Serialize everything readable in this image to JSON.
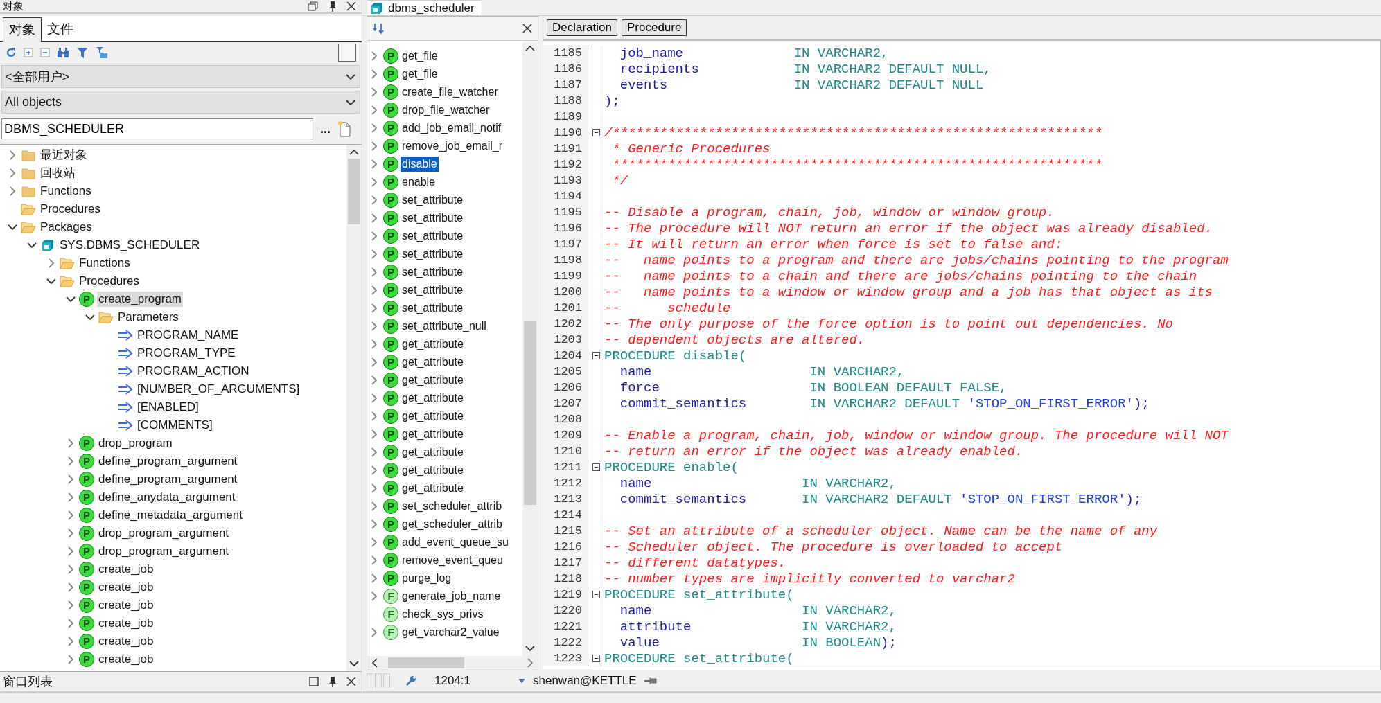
{
  "left_panel": {
    "title": "对象",
    "tabs": [
      {
        "label": "对象",
        "selected": true
      },
      {
        "label": "文件",
        "selected": false
      }
    ],
    "owner_dropdown": {
      "value": "<全部用户>"
    },
    "type_dropdown": {
      "value": "All objects"
    },
    "filter": {
      "value": "DBMS_SCHEDULER",
      "browse_button": "..."
    },
    "tree": [
      {
        "label": "最近对象",
        "kind": "folder",
        "expanded": false,
        "selected": false
      },
      {
        "label": "回收站",
        "kind": "folder",
        "expanded": false,
        "selected": false
      },
      {
        "label": "Functions",
        "kind": "folder",
        "expanded": false,
        "selected": false
      },
      {
        "label": "Procedures",
        "kind": "open-folder",
        "selected": false
      },
      {
        "label": "Packages",
        "kind": "open-folder",
        "expanded": true,
        "selected": false,
        "children": [
          {
            "label": "SYS.DBMS_SCHEDULER",
            "kind": "package",
            "expanded": true,
            "selected": false,
            "children": [
              {
                "label": "Functions",
                "kind": "open-folder",
                "expanded": false,
                "selected": false
              },
              {
                "label": "Procedures",
                "kind": "open-folder",
                "expanded": true,
                "selected": false,
                "children": [
                  {
                    "label": "create_program",
                    "kind": "procedure",
                    "badge": "P",
                    "expanded": true,
                    "selected": true,
                    "children": [
                      {
                        "label": "Parameters",
                        "kind": "open-folder",
                        "expanded": true,
                        "selected": false,
                        "children": [
                          {
                            "label": "PROGRAM_NAME",
                            "kind": "parameter",
                            "selected": false
                          },
                          {
                            "label": "PROGRAM_TYPE",
                            "kind": "parameter",
                            "selected": false
                          },
                          {
                            "label": "PROGRAM_ACTION",
                            "kind": "parameter",
                            "selected": false
                          },
                          {
                            "label": "[NUMBER_OF_ARGUMENTS]",
                            "kind": "parameter",
                            "selected": false
                          },
                          {
                            "label": "[ENABLED]",
                            "kind": "parameter",
                            "selected": false
                          },
                          {
                            "label": "[COMMENTS]",
                            "kind": "parameter",
                            "selected": false
                          }
                        ]
                      }
                    ]
                  },
                  {
                    "label": "drop_program",
                    "kind": "procedure",
                    "badge": "P",
                    "expanded": false,
                    "selected": false
                  },
                  {
                    "label": "define_program_argument",
                    "kind": "procedure",
                    "badge": "P",
                    "expanded": false,
                    "selected": false
                  },
                  {
                    "label": "define_program_argument",
                    "kind": "procedure",
                    "badge": "P",
                    "expanded": false,
                    "selected": false
                  },
                  {
                    "label": "define_anydata_argument",
                    "kind": "procedure",
                    "badge": "P",
                    "expanded": false,
                    "selected": false
                  },
                  {
                    "label": "define_metadata_argument",
                    "kind": "procedure",
                    "badge": "P",
                    "expanded": false,
                    "selected": false
                  },
                  {
                    "label": "drop_program_argument",
                    "kind": "procedure",
                    "badge": "P",
                    "expanded": false,
                    "selected": false
                  },
                  {
                    "label": "drop_program_argument",
                    "kind": "procedure",
                    "badge": "P",
                    "expanded": false,
                    "selected": false
                  },
                  {
                    "label": "create_job",
                    "kind": "procedure",
                    "badge": "P",
                    "expanded": false,
                    "selected": false
                  },
                  {
                    "label": "create_job",
                    "kind": "procedure",
                    "badge": "P",
                    "expanded": false,
                    "selected": false
                  },
                  {
                    "label": "create_job",
                    "kind": "procedure",
                    "badge": "P",
                    "expanded": false,
                    "selected": false
                  },
                  {
                    "label": "create_job",
                    "kind": "procedure",
                    "badge": "P",
                    "expanded": false,
                    "selected": false
                  },
                  {
                    "label": "create_job",
                    "kind": "procedure",
                    "badge": "P",
                    "expanded": false,
                    "selected": false
                  },
                  {
                    "label": "create_job",
                    "kind": "procedure",
                    "badge": "P",
                    "expanded": false,
                    "selected": false
                  }
                ]
              }
            ]
          }
        ]
      }
    ]
  },
  "window_list": {
    "title": "窗口列表"
  },
  "editor": {
    "tab": {
      "label": "dbms_scheduler",
      "selected": true
    },
    "outline": [
      {
        "label": "get_file",
        "kind": "procedure",
        "badge": "P",
        "expanded": false,
        "selected": false
      },
      {
        "label": "get_file",
        "kind": "procedure",
        "badge": "P",
        "expanded": false,
        "selected": false
      },
      {
        "label": "create_file_watcher",
        "kind": "procedure",
        "badge": "P",
        "expanded": false,
        "selected": false
      },
      {
        "label": "drop_file_watcher",
        "kind": "procedure",
        "badge": "P",
        "expanded": false,
        "selected": false
      },
      {
        "label": "add_job_email_notif",
        "kind": "procedure",
        "badge": "P",
        "expanded": false,
        "selected": false
      },
      {
        "label": "remove_job_email_r",
        "kind": "procedure",
        "badge": "P",
        "expanded": false,
        "selected": false
      },
      {
        "label": "disable",
        "kind": "procedure",
        "badge": "P",
        "expanded": false,
        "selected": true
      },
      {
        "label": "enable",
        "kind": "procedure",
        "badge": "P",
        "expanded": false,
        "selected": false
      },
      {
        "label": "set_attribute",
        "kind": "procedure",
        "badge": "P",
        "expanded": false,
        "selected": false
      },
      {
        "label": "set_attribute",
        "kind": "procedure",
        "badge": "P",
        "expanded": false,
        "selected": false
      },
      {
        "label": "set_attribute",
        "kind": "procedure",
        "badge": "P",
        "expanded": false,
        "selected": false
      },
      {
        "label": "set_attribute",
        "kind": "procedure",
        "badge": "P",
        "expanded": false,
        "selected": false
      },
      {
        "label": "set_attribute",
        "kind": "procedure",
        "badge": "P",
        "expanded": false,
        "selected": false
      },
      {
        "label": "set_attribute",
        "kind": "procedure",
        "badge": "P",
        "expanded": false,
        "selected": false
      },
      {
        "label": "set_attribute",
        "kind": "procedure",
        "badge": "P",
        "expanded": false,
        "selected": false
      },
      {
        "label": "set_attribute_null",
        "kind": "procedure",
        "badge": "P",
        "expanded": false,
        "selected": false
      },
      {
        "label": "get_attribute",
        "kind": "procedure",
        "badge": "P",
        "expanded": false,
        "selected": false
      },
      {
        "label": "get_attribute",
        "kind": "procedure",
        "badge": "P",
        "expanded": false,
        "selected": false
      },
      {
        "label": "get_attribute",
        "kind": "procedure",
        "badge": "P",
        "expanded": false,
        "selected": false
      },
      {
        "label": "get_attribute",
        "kind": "procedure",
        "badge": "P",
        "expanded": false,
        "selected": false
      },
      {
        "label": "get_attribute",
        "kind": "procedure",
        "badge": "P",
        "expanded": false,
        "selected": false
      },
      {
        "label": "get_attribute",
        "kind": "procedure",
        "badge": "P",
        "expanded": false,
        "selected": false
      },
      {
        "label": "get_attribute",
        "kind": "procedure",
        "badge": "P",
        "expanded": false,
        "selected": false
      },
      {
        "label": "get_attribute",
        "kind": "procedure",
        "badge": "P",
        "expanded": false,
        "selected": false
      },
      {
        "label": "get_attribute",
        "kind": "procedure",
        "badge": "P",
        "expanded": false,
        "selected": false
      },
      {
        "label": "set_scheduler_attrib",
        "kind": "procedure",
        "badge": "P",
        "expanded": false,
        "selected": false
      },
      {
        "label": "get_scheduler_attrib",
        "kind": "procedure",
        "badge": "P",
        "expanded": false,
        "selected": false
      },
      {
        "label": "add_event_queue_su",
        "kind": "procedure",
        "badge": "P",
        "expanded": false,
        "selected": false
      },
      {
        "label": "remove_event_queu",
        "kind": "procedure",
        "badge": "P",
        "expanded": false,
        "selected": false
      },
      {
        "label": "purge_log",
        "kind": "procedure",
        "badge": "P",
        "expanded": false,
        "selected": false
      },
      {
        "label": "generate_job_name",
        "kind": "function",
        "badge": "F",
        "expanded": false,
        "selected": false
      },
      {
        "label": "check_sys_privs",
        "kind": "function",
        "badge": "F",
        "selected": false
      },
      {
        "label": "get_varchar2_value",
        "kind": "function",
        "badge": "F",
        "expanded": false,
        "selected": false
      }
    ],
    "view_buttons": [
      "Declaration",
      "Procedure"
    ],
    "lines": [
      {
        "number": "1185",
        "fold": false,
        "segments": [
          {
            "kind": "ident",
            "text": "  job_name              "
          },
          {
            "kind": "keyword",
            "text": "IN VARCHAR2,"
          }
        ]
      },
      {
        "number": "1186",
        "fold": false,
        "segments": [
          {
            "kind": "ident",
            "text": "  recipients            "
          },
          {
            "kind": "keyword",
            "text": "IN VARCHAR2 DEFAULT NULL,"
          }
        ]
      },
      {
        "number": "1187",
        "fold": false,
        "segments": [
          {
            "kind": "ident",
            "text": "  events                "
          },
          {
            "kind": "keyword",
            "text": "IN VARCHAR2 DEFAULT NULL"
          }
        ]
      },
      {
        "number": "1188",
        "fold": false,
        "segments": [
          {
            "kind": "ident",
            "text": ");"
          }
        ]
      },
      {
        "number": "1189",
        "fold": false
      },
      {
        "number": "1190",
        "fold": true,
        "segments": [
          {
            "kind": "comment",
            "text": "/**************************************************************"
          }
        ]
      },
      {
        "number": "1191",
        "fold": false,
        "segments": [
          {
            "kind": "comment",
            "text": " * Generic Procedures"
          }
        ]
      },
      {
        "number": "1192",
        "fold": false,
        "segments": [
          {
            "kind": "comment",
            "text": " **************************************************************"
          }
        ]
      },
      {
        "number": "1193",
        "fold": false,
        "segments": [
          {
            "kind": "comment",
            "text": " */"
          }
        ]
      },
      {
        "number": "1194",
        "fold": false
      },
      {
        "number": "1195",
        "fold": false,
        "segments": [
          {
            "kind": "comment",
            "text": "-- Disable a program, chain, job, window or window_group."
          }
        ]
      },
      {
        "number": "1196",
        "fold": false,
        "segments": [
          {
            "kind": "comment",
            "text": "-- The procedure will NOT return an error if the object was already disabled."
          }
        ]
      },
      {
        "number": "1197",
        "fold": false,
        "segments": [
          {
            "kind": "comment",
            "text": "-- It will return an error when force is set to false and:"
          }
        ]
      },
      {
        "number": "1198",
        "fold": false,
        "segments": [
          {
            "kind": "comment",
            "text": "--   name points to a program and there are jobs/chains pointing to the program"
          }
        ]
      },
      {
        "number": "1199",
        "fold": false,
        "segments": [
          {
            "kind": "comment",
            "text": "--   name points to a chain and there are jobs/chains pointing to the chain"
          }
        ]
      },
      {
        "number": "1200",
        "fold": false,
        "segments": [
          {
            "kind": "comment",
            "text": "--   name points to a window or window group and a job has that object as its"
          }
        ]
      },
      {
        "number": "1201",
        "fold": false,
        "segments": [
          {
            "kind": "comment",
            "text": "--      schedule"
          }
        ]
      },
      {
        "number": "1202",
        "fold": false,
        "segments": [
          {
            "kind": "comment",
            "text": "-- The only purpose of the force option is to point out dependencies. No"
          }
        ]
      },
      {
        "number": "1203",
        "fold": false,
        "segments": [
          {
            "kind": "comment",
            "text": "-- dependent objects are altered."
          }
        ]
      },
      {
        "number": "1204",
        "fold": true,
        "segments": [
          {
            "kind": "keyword",
            "text": "PROCEDURE disable("
          }
        ]
      },
      {
        "number": "1205",
        "fold": false,
        "segments": [
          {
            "kind": "ident",
            "text": "  name                    "
          },
          {
            "kind": "keyword",
            "text": "IN VARCHAR2,"
          }
        ]
      },
      {
        "number": "1206",
        "fold": false,
        "segments": [
          {
            "kind": "ident",
            "text": "  force                   "
          },
          {
            "kind": "keyword",
            "text": "IN BOOLEAN DEFAULT FALSE,"
          }
        ]
      },
      {
        "number": "1207",
        "fold": false,
        "segments": [
          {
            "kind": "ident",
            "text": "  commit_semantics        "
          },
          {
            "kind": "keyword",
            "text": "IN VARCHAR2 DEFAULT "
          },
          {
            "kind": "string",
            "text": "'STOP_ON_FIRST_ERROR'"
          },
          {
            "kind": "ident",
            "text": ");"
          }
        ]
      },
      {
        "number": "1208",
        "fold": false
      },
      {
        "number": "1209",
        "fold": false,
        "segments": [
          {
            "kind": "comment",
            "text": "-- Enable a program, chain, job, window or window group. The procedure will NOT"
          }
        ]
      },
      {
        "number": "1210",
        "fold": false,
        "segments": [
          {
            "kind": "comment",
            "text": "-- return an error if the object was already enabled."
          }
        ]
      },
      {
        "number": "1211",
        "fold": true,
        "segments": [
          {
            "kind": "keyword",
            "text": "PROCEDURE enable("
          }
        ]
      },
      {
        "number": "1212",
        "fold": false,
        "segments": [
          {
            "kind": "ident",
            "text": "  name                   "
          },
          {
            "kind": "keyword",
            "text": "IN VARCHAR2,"
          }
        ]
      },
      {
        "number": "1213",
        "fold": false,
        "segments": [
          {
            "kind": "ident",
            "text": "  commit_semantics       "
          },
          {
            "kind": "keyword",
            "text": "IN VARCHAR2 DEFAULT "
          },
          {
            "kind": "string",
            "text": "'STOP_ON_FIRST_ERROR'"
          },
          {
            "kind": "ident",
            "text": ");"
          }
        ]
      },
      {
        "number": "1214",
        "fold": false
      },
      {
        "number": "1215",
        "fold": false,
        "segments": [
          {
            "kind": "comment",
            "text": "-- Set an attribute of a scheduler object. Name can be the name of any"
          }
        ]
      },
      {
        "number": "1216",
        "fold": false,
        "segments": [
          {
            "kind": "comment",
            "text": "-- Scheduler object. The procedure is overloaded to accept"
          }
        ]
      },
      {
        "number": "1217",
        "fold": false,
        "segments": [
          {
            "kind": "comment",
            "text": "-- different datatypes."
          }
        ]
      },
      {
        "number": "1218",
        "fold": false,
        "segments": [
          {
            "kind": "comment",
            "text": "-- number types are implicitly converted to varchar2"
          }
        ]
      },
      {
        "number": "1219",
        "fold": true,
        "segments": [
          {
            "kind": "keyword",
            "text": "PROCEDURE set_attribute("
          }
        ]
      },
      {
        "number": "1220",
        "fold": false,
        "segments": [
          {
            "kind": "ident",
            "text": "  name                   "
          },
          {
            "kind": "keyword",
            "text": "IN VARCHAR2,"
          }
        ]
      },
      {
        "number": "1221",
        "fold": false,
        "segments": [
          {
            "kind": "ident",
            "text": "  attribute              "
          },
          {
            "kind": "keyword",
            "text": "IN VARCHAR2,"
          }
        ]
      },
      {
        "number": "1222",
        "fold": false,
        "segments": [
          {
            "kind": "ident",
            "text": "  value                  "
          },
          {
            "kind": "keyword",
            "text": "IN BOOLEAN"
          },
          {
            "kind": "ident",
            "text": ");"
          }
        ]
      },
      {
        "number": "1223",
        "fold": true,
        "segments": [
          {
            "kind": "keyword",
            "text": "PROCEDURE set_attribute("
          }
        ]
      }
    ]
  },
  "status_bar": {
    "position": "1204:1",
    "connection": "shenwan@KETTLE"
  }
}
